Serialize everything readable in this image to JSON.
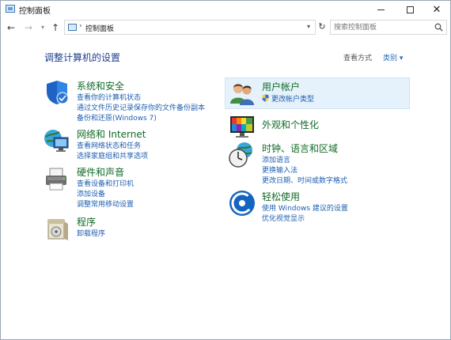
{
  "window": {
    "title": "控制面板"
  },
  "address": {
    "path": "控制面板",
    "separator": "›"
  },
  "search": {
    "placeholder": "搜索控制面板"
  },
  "main": {
    "title": "调整计算机的设置",
    "view_by_label": "查看方式",
    "view_by_value": "类别 ▾"
  },
  "categories": {
    "system": {
      "title": "系统和安全",
      "links": [
        "查看你的计算机状态",
        "通过文件历史记录保存你的文件备份副本",
        "备份和还原(Windows 7)"
      ]
    },
    "network": {
      "title": "网络和 Internet",
      "links": [
        "查看网络状态和任务",
        "选择家庭组和共享选项"
      ]
    },
    "hardware": {
      "title": "硬件和声音",
      "links": [
        "查看设备和打印机",
        "添加设备",
        "调整常用移动设置"
      ]
    },
    "programs": {
      "title": "程序",
      "links": [
        "卸载程序"
      ]
    },
    "user": {
      "title": "用户帐户",
      "links": [
        "更改帐户类型"
      ]
    },
    "appearance": {
      "title": "外观和个性化",
      "links": []
    },
    "clock": {
      "title": "时钟、语言和区域",
      "links": [
        "添加语言",
        "更换输入法",
        "更改日期、时间或数字格式"
      ]
    },
    "ease": {
      "title": "轻松使用",
      "links": [
        "使用 Windows 建议的设置",
        "优化视觉显示"
      ]
    }
  },
  "colors": {
    "title_blue": "#1e3d8f",
    "category_green": "#116b28",
    "link_blue": "#1f5fb0",
    "hover_bg": "#e5f1fb"
  }
}
